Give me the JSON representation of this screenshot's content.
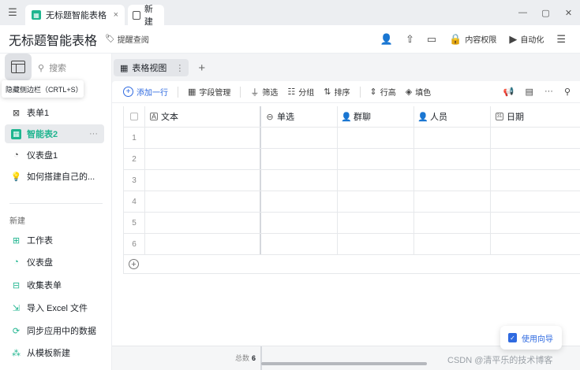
{
  "titlebar": {
    "tabs": [
      {
        "label": "无标题智能表格",
        "active": true
      },
      {
        "label": "新建",
        "active": false
      }
    ],
    "close_glyph": "×",
    "window_controls": [
      "—",
      "▢",
      "✕"
    ]
  },
  "header": {
    "title": "无标题智能表格",
    "remind_label": "提醒查阅",
    "permission_label": "内容权限",
    "automation_label": "自动化"
  },
  "sidebar": {
    "search_placeholder": "搜索",
    "tooltip": "隐藏侧边栏（CRTL+S）",
    "items": [
      {
        "label": "表单1",
        "icon": "form-icon"
      },
      {
        "label": "智能表2",
        "icon": "smart-table-icon",
        "active": true
      },
      {
        "label": "仪表盘1",
        "icon": "dashboard-icon"
      },
      {
        "label": "如何搭建自己的...",
        "icon": "bulb-icon"
      }
    ],
    "more_glyph": "···",
    "section_label": "新建",
    "new_items": [
      {
        "label": "工作表",
        "icon": "worksheet-icon"
      },
      {
        "label": "仪表盘",
        "icon": "dashboard-add-icon"
      },
      {
        "label": "收集表单",
        "icon": "collect-form-icon"
      },
      {
        "label": "导入 Excel 文件",
        "icon": "import-icon"
      },
      {
        "label": "同步应用中的数据",
        "icon": "sync-icon"
      },
      {
        "label": "从模板新建",
        "icon": "template-icon"
      }
    ]
  },
  "main": {
    "view_tab_label": "表格视图",
    "view_tab_more": "⋮",
    "add_view_glyph": "+",
    "toolbar": {
      "add_row": "添加一行",
      "fields": "字段管理",
      "filter": "筛选",
      "group": "分组",
      "sort": "排序",
      "row_height": "行高",
      "fill_color": "填色"
    },
    "columns": [
      {
        "label": "文本",
        "icon": "A"
      },
      {
        "label": "单选",
        "icon": "⊖"
      },
      {
        "label": "群聊",
        "icon": "👤"
      },
      {
        "label": "人员",
        "icon": "👤"
      },
      {
        "label": "日期",
        "icon": "31"
      }
    ],
    "rows": [
      "1",
      "2",
      "3",
      "4",
      "5",
      "6"
    ],
    "add_row_glyph": "+",
    "total_label": "总数",
    "total_value": "6"
  },
  "guide_label": "使用向导",
  "watermark": "CSDN @清平乐的技术博客"
}
